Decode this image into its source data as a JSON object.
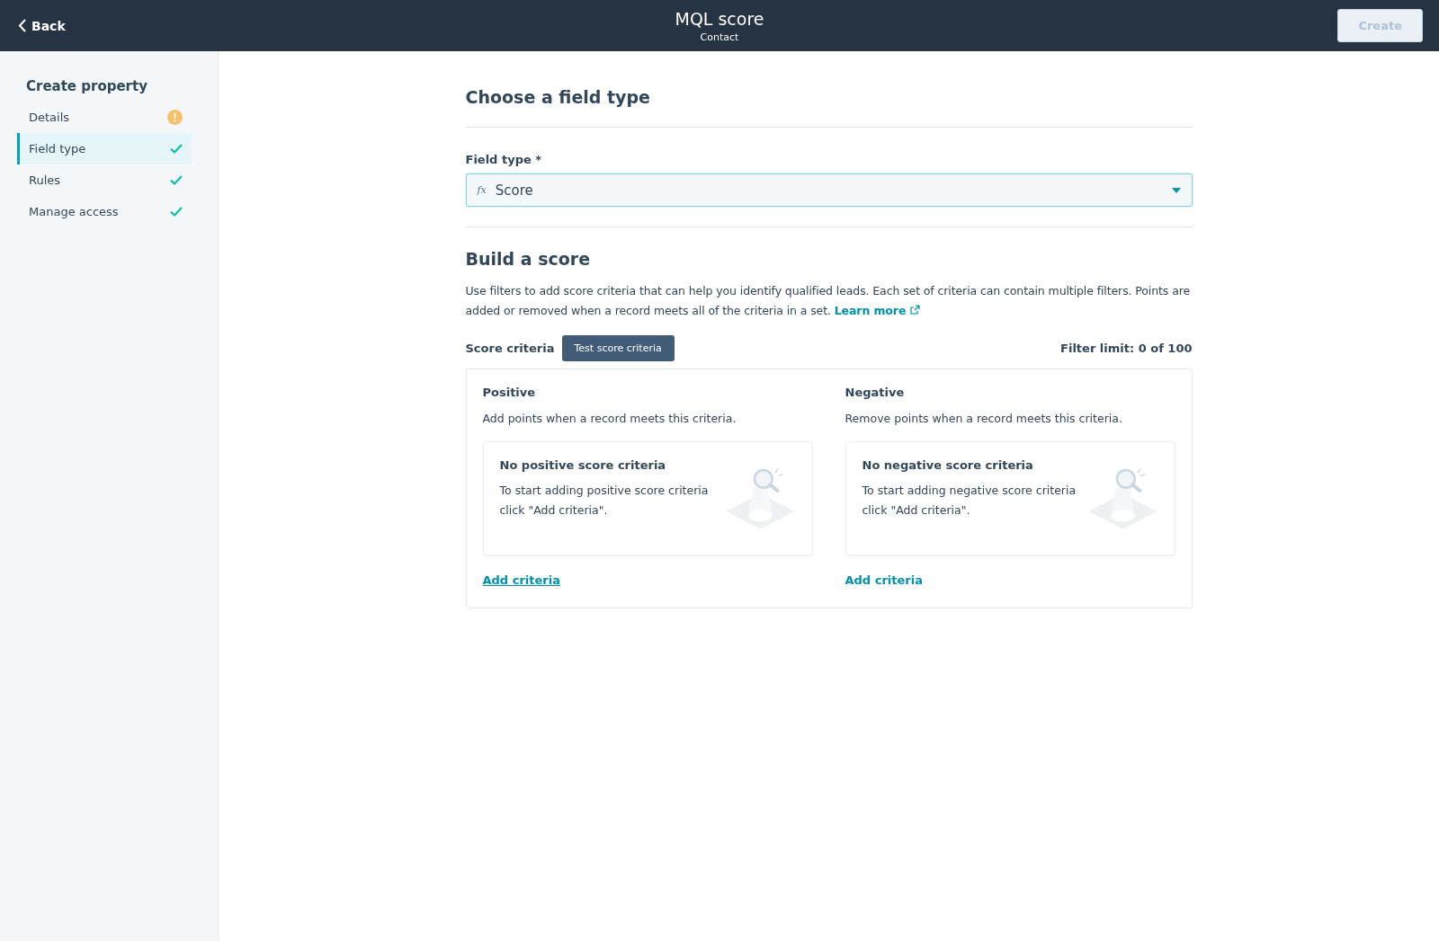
{
  "header": {
    "back": "Back",
    "title": "MQL score",
    "subtitle": "Contact",
    "create_button": {
      "label": "Create",
      "disabled": true
    }
  },
  "sidebar": {
    "title": "Create property",
    "items": [
      {
        "label": "Details",
        "kind": "warning",
        "selected": false
      },
      {
        "label": "Field type",
        "kind": "done",
        "selected": true
      },
      {
        "label": "Rules",
        "kind": "done",
        "selected": false
      },
      {
        "label": "Manage access",
        "kind": "done",
        "selected": false
      }
    ]
  },
  "field_section": {
    "title": "Choose a field type",
    "field_label": "Field type *",
    "field_icon": "fx",
    "field_value": "Score"
  },
  "score_section": {
    "title": "Build a score",
    "description": "Use filters to add score criteria that can help you identify qualified leads. Each set of criteria can contain multiple filters. Points are added or removed when a record meets all of the criteria in a set.",
    "learn_more": "Learn more",
    "criteria_label": "Score criteria",
    "test_button": "Test score criteria",
    "filter_limit": "Filter limit: 0 of 100",
    "columns": [
      {
        "title": "Positive",
        "description": "Add points when a record meets this criteria.",
        "empty_title": "No positive score criteria",
        "empty_text": "To start adding positive score criteria click \"Add criteria\".",
        "link": "Add criteria"
      },
      {
        "title": "Negative",
        "description": "Remove points when a record meets this criteria.",
        "empty_title": "No negative score criteria",
        "empty_text": "To start adding negative score criteria click \"Add criteria\".",
        "link": "Add criteria"
      }
    ]
  }
}
